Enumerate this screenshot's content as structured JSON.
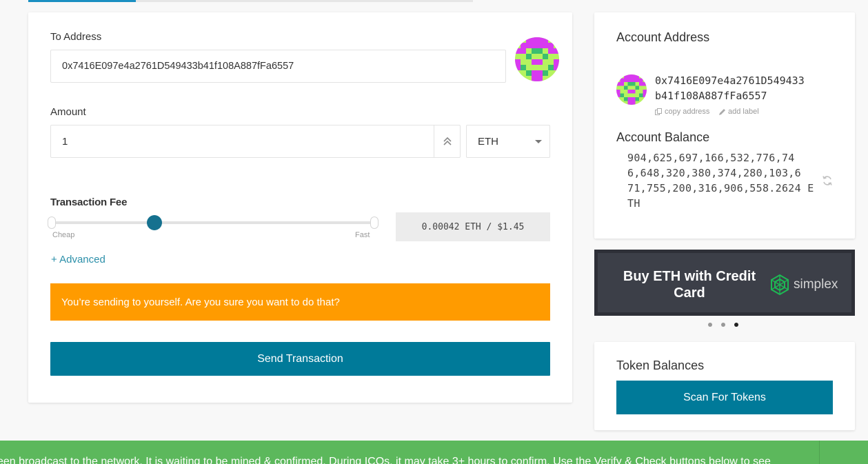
{
  "send_form": {
    "to_address_label": "To Address",
    "to_address_value": "0x7416E097e4a2761D549433b41f108A887fFa6557",
    "amount_label": "Amount",
    "amount_value": "1",
    "unit_selected": "ETH",
    "fee_label": "Transaction Fee",
    "fee_slider_level": 0.32,
    "fee_cheap": "Cheap",
    "fee_fast": "Fast",
    "fee_value": "0.00042 ETH / $1.45",
    "advanced_link": "+ Advanced",
    "warning_text": "You’re sending to yourself. Are you sure you want to do that?",
    "send_button": "Send Transaction"
  },
  "account": {
    "title": "Account Address",
    "address_line1": "0x7416E097e4a2761D549433",
    "address_line2": "b41f108A887fFa6557",
    "copy_address": "copy address",
    "add_label": "add label",
    "balance_title": "Account Balance",
    "balance_lines": [
      "904,625,697,166,532,776,74",
      "6,648,320,380,374,280,103,6",
      "71,755,200,316,906,558.2624 E",
      "TH"
    ]
  },
  "promo": {
    "text": "Buy ETH with Credit Card",
    "brand": "simplex",
    "carousel_dots": 3,
    "active_dot": 2
  },
  "tokens": {
    "title": "Token Balances",
    "scan_button": "Scan For Tokens"
  },
  "notification": {
    "text": "een broadcast to the network. It is waiting to be mined & confirmed. During ICOs, it may take 3+ hours to confirm. Use the Verify & Check buttons below to see"
  },
  "colors": {
    "primary": "#007a99",
    "warning": "#ff9b00",
    "success": "#5cb85c",
    "identicon_green": "#b6f35f",
    "identicon_magenta": "#d83af0"
  },
  "icons": [
    "identicon",
    "chevron-double-up-icon",
    "caret-down-icon",
    "copy-icon",
    "pencil-icon",
    "refresh-icon",
    "simplex-logo-icon"
  ]
}
